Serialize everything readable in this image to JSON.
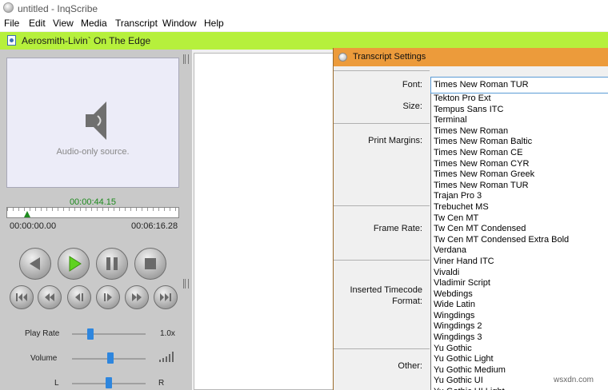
{
  "window": {
    "title": "untitled - InqScribe"
  },
  "menu": [
    "File",
    "Edit",
    "View",
    "Media",
    "Transcript",
    "Window",
    "Help"
  ],
  "media_bar": {
    "file_name": "Aerosmith-Livin` On The Edge"
  },
  "player": {
    "preview_text": "Audio-only source.",
    "current_time": "00:00:44.15",
    "start_time": "00:00:00.00",
    "end_time": "00:06:16.28",
    "playhead_fraction": 0.117,
    "play_rate": {
      "label": "Play Rate",
      "value": "1.0x",
      "position": 0.25
    },
    "volume": {
      "label": "Volume",
      "position": 0.52
    },
    "balance": {
      "left": "L",
      "right": "R",
      "position": 0.5
    }
  },
  "dialog": {
    "title": "Transcript Settings",
    "labels": {
      "font": "Font:",
      "size": "Size:",
      "print_margins": "Print Margins:",
      "frame_rate": "Frame Rate:",
      "inserted_timecode": "Inserted Timecode",
      "inserted_timecode_2": "Format:",
      "other": "Other:"
    },
    "font_selected": "Times New Roman TUR",
    "font_options": [
      "Tekton Pro Ext",
      "Tempus Sans ITC",
      "Terminal",
      "Times New Roman",
      "Times New Roman Baltic",
      "Times New Roman CE",
      "Times New Roman CYR",
      "Times New Roman Greek",
      "Times New Roman TUR",
      "Trajan Pro 3",
      "Trebuchet MS",
      "Tw Cen MT",
      "Tw Cen MT Condensed",
      "Tw Cen MT Condensed Extra Bold",
      "Verdana",
      "Viner Hand ITC",
      "Vivaldi",
      "Vladimir Script",
      "Webdings",
      "Wide Latin",
      "Wingdings",
      "Wingdings 2",
      "Wingdings 3",
      "Yu Gothic",
      "Yu Gothic Light",
      "Yu Gothic Medium",
      "Yu Gothic UI",
      "Yu Gothic UI Light"
    ]
  },
  "watermark": "wsxdn.com",
  "colors": {
    "media_bar": "#b6f03c",
    "dialog_title": "#ec9b3b",
    "accent_blue": "#2e86de",
    "time_green": "#1d8a1d"
  }
}
